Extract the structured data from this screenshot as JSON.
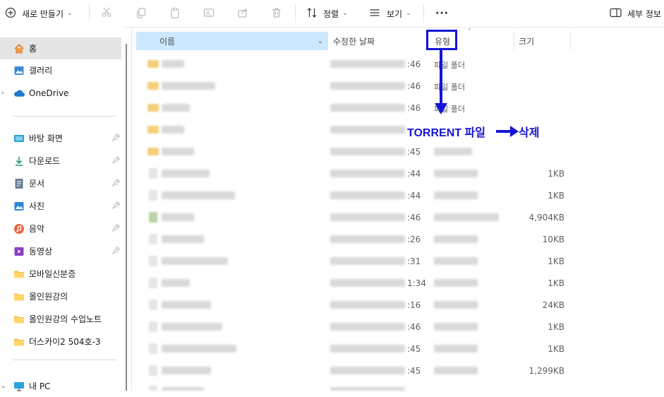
{
  "toolbar": {
    "new_label": "새로 만들기",
    "sort_label": "정렬",
    "view_label": "보기",
    "more_label": "···",
    "details_label": "세부 정보"
  },
  "sidebar": {
    "items": [
      {
        "label": "홈",
        "icon": "home-icon"
      },
      {
        "label": "갤러리",
        "icon": "gallery-icon"
      },
      {
        "label": "OneDrive",
        "icon": "cloud-icon"
      },
      {
        "label": "바탕 화면",
        "icon": "desktop-icon"
      },
      {
        "label": "다운로드",
        "icon": "download-icon"
      },
      {
        "label": "문서",
        "icon": "document-icon"
      },
      {
        "label": "사진",
        "icon": "picture-icon"
      },
      {
        "label": "음악",
        "icon": "music-icon"
      },
      {
        "label": "동영상",
        "icon": "video-icon"
      },
      {
        "label": "모바일신분증",
        "icon": "folder-icon"
      },
      {
        "label": "올인원강의",
        "icon": "folder-icon"
      },
      {
        "label": "올인원강의 수업노트",
        "icon": "folder-icon"
      },
      {
        "label": "더스카이2 504호-3",
        "icon": "folder-icon"
      },
      {
        "label": "내 PC",
        "icon": "pc-icon"
      }
    ]
  },
  "columns": {
    "name": "이름",
    "date": "수정한 날짜",
    "type": "유형",
    "size": "크기"
  },
  "rows": [
    {
      "kind": "folder",
      "date": ":46",
      "type": "파일 폴더",
      "size": ""
    },
    {
      "kind": "folder",
      "date": ":46",
      "type": "파일 폴더",
      "size": ""
    },
    {
      "kind": "folder",
      "date": ":46",
      "type": "파일 폴더",
      "size": ""
    },
    {
      "kind": "folder",
      "date": "",
      "type": "",
      "size": ""
    },
    {
      "kind": "folder",
      "date": ":45",
      "type": "",
      "size": ""
    },
    {
      "kind": "file",
      "date": ":44",
      "type": "",
      "size": "1KB"
    },
    {
      "kind": "file",
      "date": ":44",
      "type": "",
      "size": "1KB"
    },
    {
      "kind": "file",
      "date": ":46",
      "type": "",
      "size": "4,904KB"
    },
    {
      "kind": "file",
      "date": ":26",
      "type": "",
      "size": "10KB"
    },
    {
      "kind": "file",
      "date": ":31",
      "type": "",
      "size": "1KB"
    },
    {
      "kind": "file",
      "date": "1:34",
      "type": "",
      "size": "1KB"
    },
    {
      "kind": "file",
      "date": ":16",
      "type": "",
      "size": "24KB"
    },
    {
      "kind": "file",
      "date": ":46",
      "type": "",
      "size": "1KB"
    },
    {
      "kind": "file",
      "date": ":45",
      "type": "",
      "size": "1KB"
    },
    {
      "kind": "file",
      "date": ":45",
      "type": "",
      "size": "1,299KB"
    }
  ],
  "annotation": {
    "text": "TORRENT 파일",
    "action": "삭제",
    "color": "#1515d6"
  },
  "colors": {
    "selected_header": "#cce8ff",
    "selected_nav": "#e5e5e5",
    "folder": "#f5cf7a"
  }
}
